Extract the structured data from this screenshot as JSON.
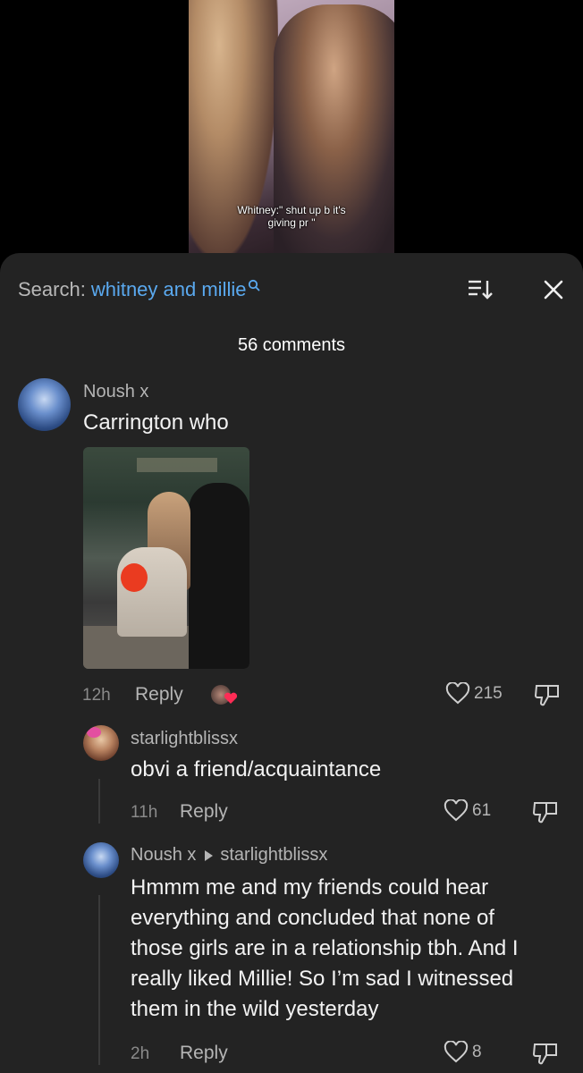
{
  "video": {
    "caption_line1": "Whitney:\" shut up b it's",
    "caption_line2": "giving pr \""
  },
  "search": {
    "label": "Search:",
    "query": "whitney and millie"
  },
  "comments_count": "56 comments",
  "comments": [
    {
      "username": "Noush x",
      "text": "Carrington who",
      "time": "12h",
      "reply_label": "Reply",
      "likes": "215",
      "has_image": true
    },
    {
      "username": "starlightblissx",
      "text": "obvi a friend/acquaintance",
      "time": "11h",
      "reply_label": "Reply",
      "likes": "61"
    },
    {
      "username": "Noush x",
      "reply_to": "starlightblissx",
      "text_lines": [
        "Hmmm me and my friends could hear",
        "everything and concluded that none of",
        "those girls are in a relationship tbh. And I",
        "really liked Millie! So I’m sad I witnessed",
        "them in the wild yesterday"
      ],
      "time": "2h",
      "reply_label": "Reply",
      "likes": "8"
    }
  ],
  "colors": {
    "sheet_bg": "#232323",
    "accent_blue": "#5aa9ef",
    "liked_heart": "#fe2c55"
  },
  "icons": [
    "search-icon",
    "sort-icon",
    "close-icon",
    "heart-icon",
    "dislike-icon"
  ]
}
